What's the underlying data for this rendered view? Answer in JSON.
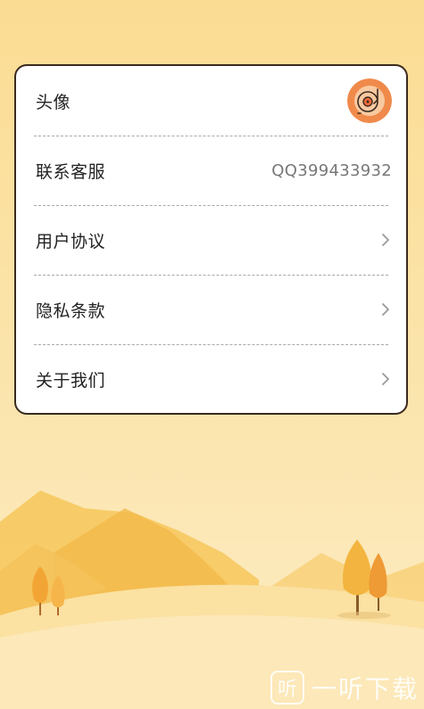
{
  "settings": {
    "items": [
      {
        "label": "头像",
        "type": "avatar",
        "icon": "vinyl-record-avatar-icon"
      },
      {
        "label": "联系客服",
        "type": "value",
        "value": "QQ399433932"
      },
      {
        "label": "用户协议",
        "type": "link",
        "icon": "chevron-right-icon"
      },
      {
        "label": "隐私条款",
        "type": "link",
        "icon": "chevron-right-icon"
      },
      {
        "label": "关于我们",
        "type": "link",
        "icon": "chevron-right-icon"
      }
    ]
  },
  "watermark": {
    "icon_text": "听",
    "text": "一听下载"
  },
  "colors": {
    "background": "#fbdc93",
    "card_border": "#3b2a1f",
    "avatar": "#f08a4b"
  }
}
